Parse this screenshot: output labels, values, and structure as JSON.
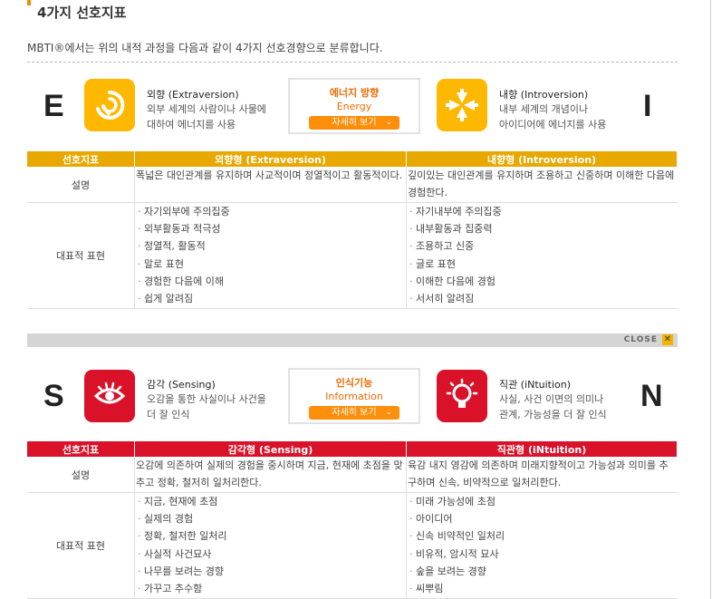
{
  "page_title": "4가지 선호지표",
  "intro": "MBTI®에서는 위의 내적 과정을 다음과 같이 4가지 선호경향으로 분류합니다.",
  "section1": {
    "left_letter": "E",
    "right_letter": "I",
    "left_title": "외향 (Extraversion)",
    "left_desc1": "외부 세계의 사람이나 사물에",
    "left_desc2": "대하여 에너지를 사용",
    "right_title": "내향 (Introversion)",
    "right_desc1": "내부 세계의 개념이나",
    "right_desc2": "아이디어에 에너지를 사용",
    "mid_title": "에너지 방향",
    "mid_sub": "Energy",
    "more_label": "자세히 보기",
    "header_color": "#e8a800",
    "table_head": [
      "선호지표",
      "외향형 (Extraversion)",
      "내향형 (Introversion)"
    ],
    "row1_label": "설명",
    "row1_left": "폭넓은 대인관계를 유지하며 사교적이며 정열적이고 활동적이다.",
    "row1_right": "깊이있는 대인관계를 유지하며 조용하고 신중하며 이해한 다음에 경험한다.",
    "row2_label": "대표적 표현",
    "row2_left": [
      "자기외부에 주의집중",
      "외부활동과 적극성",
      "정열적, 활동적",
      "말로 표현",
      "경험한 다음에 이해",
      "쉽게 알려짐"
    ],
    "row2_right": [
      "자기내부에 주의집중",
      "내부활동과 집중력",
      "조용하고 신중",
      "글로 표현",
      "이해한 다음에 경험",
      "서서히 알려짐"
    ]
  },
  "close_label": "CLOSE",
  "section2": {
    "left_letter": "S",
    "right_letter": "N",
    "left_title": "감각 (Sensing)",
    "left_desc1": "오감을 통한 사실이나 사건을",
    "left_desc2": "더 잘 인식",
    "right_title": "직관 (iNtuition)",
    "right_desc1": "사실, 사건 이면의 의미나",
    "right_desc2": "관계, 가능성을 더 잘 인식",
    "mid_title": "인식기능",
    "mid_sub": "Information",
    "more_label": "자세히 보기",
    "header_color": "#d9122a",
    "table_head": [
      "선호지표",
      "감각형 (Sensing)",
      "직관형 (iNtuition)"
    ],
    "row1_label": "설명",
    "row1_left": "오감에 의존하여 실제의 경험을 중시하며 지금, 현재에 초점을 맞추고 정확, 철저히 일처리한다.",
    "row1_right": "육감 내지 영감에 의존하며 미래지향적이고 가능성과 의미를 추구하며 신속, 비약적으로 일처리한다.",
    "row2_label": "대표적 표현",
    "row2_left": [
      "지금, 현재에 초점",
      "실제의 경험",
      "정확, 철저한 일처리",
      "사실적 사건묘사",
      "나무를 보려는 경향",
      "가꾸고 추수함"
    ],
    "row2_right": [
      "미래 가능성에 초점",
      "아이디어",
      "신속 비약적인 일처리",
      "비유적, 암시적 묘사",
      "숲을 보려는 경향",
      "씨뿌림"
    ]
  }
}
